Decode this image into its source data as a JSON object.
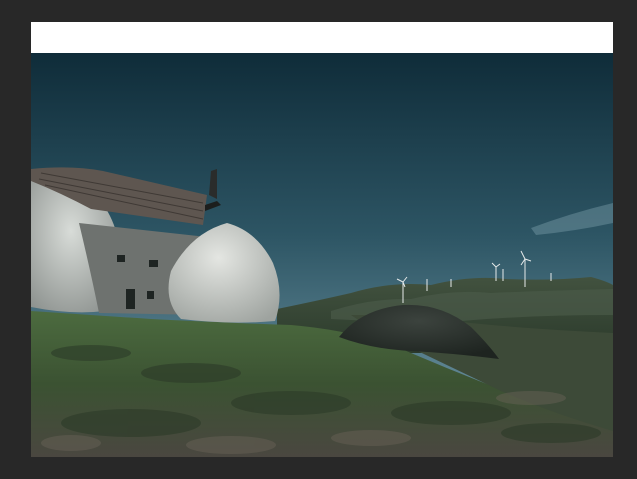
{
  "app": {
    "workspace_color": "#282828",
    "canvas_color": "#ffffff"
  },
  "document": {
    "image": {
      "subject": "stone-house-landscape",
      "palette": {
        "sky_top": "#0f2e3b",
        "sky_bottom": "#6f96a4",
        "grass": "#3a5a34",
        "rock": "#cfd2cf",
        "roof": "#5a514c"
      }
    }
  }
}
